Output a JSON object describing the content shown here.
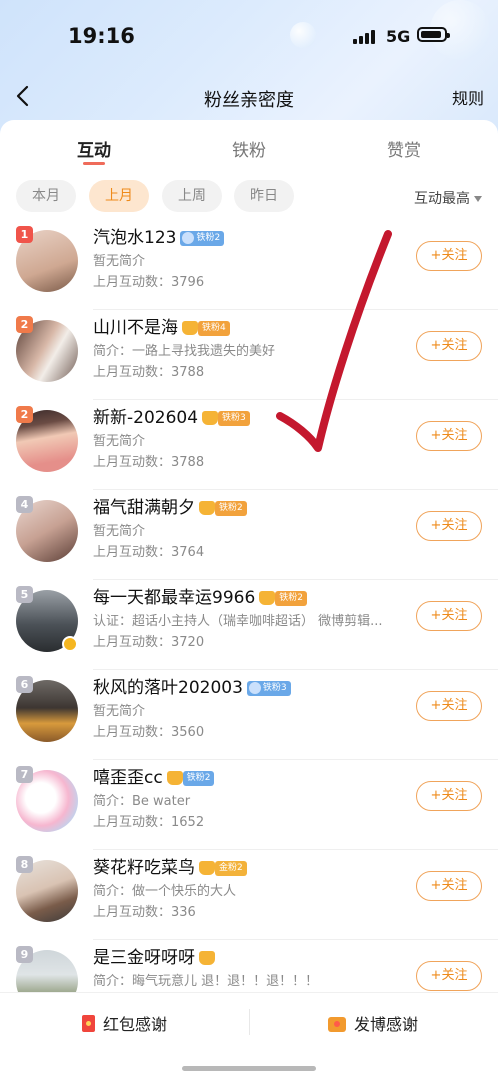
{
  "status_bar": {
    "time": "19:16",
    "network": "5G"
  },
  "nav": {
    "title": "粉丝亲密度",
    "rules": "规则"
  },
  "tabs": [
    "互动",
    "铁粉",
    "赞赏"
  ],
  "chips": [
    "本月",
    "上月",
    "上周",
    "昨日"
  ],
  "sort": "互动最高",
  "follow_label": "+关注",
  "rows": [
    {
      "rank": "1",
      "name": "汽泡水123",
      "badge": "铁粉2",
      "badge_color": "blue",
      "desc": "暂无简介",
      "count": "上月互动数：3796"
    },
    {
      "rank": "2",
      "name": "山川不是海",
      "badge": "铁粉4",
      "badge_color": "orange",
      "desc": "简介：一路上寻找我遗失的美好",
      "count": "上月互动数：3788"
    },
    {
      "rank": "2",
      "name": "新新-202604",
      "badge": "铁粉3",
      "badge_color": "orange",
      "desc": "暂无简介",
      "count": "上月互动数：3788"
    },
    {
      "rank": "4",
      "name": "福气甜满朝夕",
      "badge": "铁粉2",
      "badge_color": "orange",
      "desc": "暂无简介",
      "count": "上月互动数：3764"
    },
    {
      "rank": "5",
      "name": "每一天都最幸运9966",
      "badge": "铁粉2",
      "badge_color": "orange",
      "desc": "认证：超话小主持人（瑞幸咖啡超话） 微博剪辑...",
      "count": "上月互动数：3720"
    },
    {
      "rank": "6",
      "name": "秋风的落叶202003",
      "badge": "铁粉3",
      "badge_color": "blue",
      "desc": "暂无简介",
      "count": "上月互动数：3560"
    },
    {
      "rank": "7",
      "name": "嘻歪歪cc",
      "badge": "铁粉2",
      "badge_color": "blue",
      "desc": "简介：Be water",
      "count": "上月互动数：1652"
    },
    {
      "rank": "8",
      "name": "葵花籽吃菜鸟",
      "badge": "金粉2",
      "badge_color": "orange",
      "desc": "简介：做一个快乐的大人",
      "count": "上月互动数：336"
    },
    {
      "rank": "9",
      "name": "是三金呀呀呀",
      "badge": "",
      "badge_color": "orange",
      "desc": "简介：晦气玩意儿 退！退！！退！！！",
      "count": ""
    }
  ],
  "bottom": {
    "red_packet": "红包感谢",
    "post": "发博感谢"
  },
  "colors": {
    "accent": "#ee8a1a",
    "tab_indicator": "#ef6b5a",
    "check_mark": "#c4182e"
  }
}
